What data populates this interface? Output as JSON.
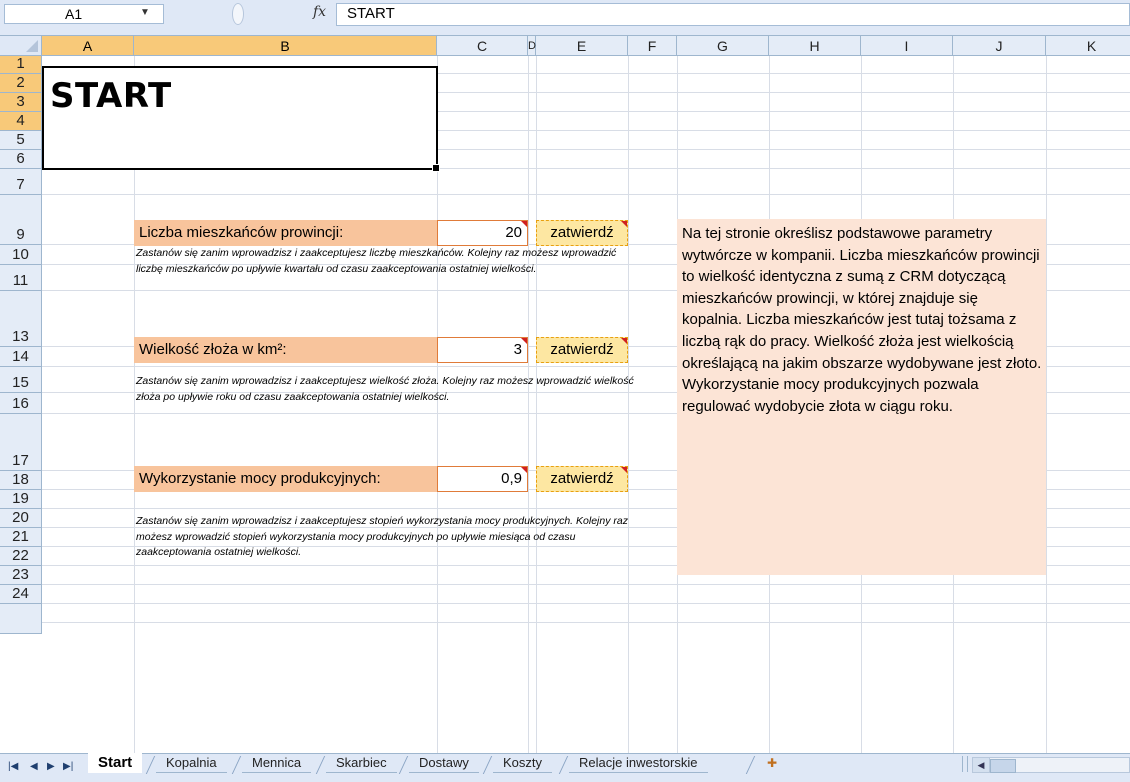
{
  "formula_bar": {
    "name_box": "A1",
    "fx": "fx",
    "formula": "START"
  },
  "columns": [
    "A",
    "B",
    "C",
    "D",
    "E",
    "F",
    "G",
    "H",
    "I",
    "J",
    "K"
  ],
  "rows": [
    "1",
    "2",
    "3",
    "4",
    "5",
    "6",
    "7",
    "9",
    "10",
    "11",
    "13",
    "14",
    "15",
    "16",
    "17",
    "18",
    "19",
    "20",
    "21",
    "22",
    "23",
    "24"
  ],
  "sheet": {
    "title": "START",
    "fields": [
      {
        "label": "Liczba mieszkańców prowincji:",
        "value": "20",
        "button": "zatwierdź",
        "note": "Zastanów się zanim wprowadzisz i zaakceptujesz liczbę mieszkańców. Kolejny raz możesz wprowadzić liczbę mieszkańców po upływie kwartału od czasu zaakceptowania ostatniej wielkości."
      },
      {
        "label": "Wielkość złoża w km²:",
        "value": "3",
        "button": "zatwierdź",
        "note": "Zastanów się zanim wprowadzisz i zaakceptujesz wielkość złoża. Kolejny raz możesz wprowadzić wielkość złoża po upływie roku od czasu zaakceptowania ostatniej wielkości."
      },
      {
        "label": "Wykorzystanie mocy produkcyjnych:",
        "value": "0,9",
        "button": "zatwierdź",
        "note": "Zastanów się zanim wprowadzisz i zaakceptujesz stopień wykorzystania mocy produkcyjnych. Kolejny raz możesz wprowadzić stopień wykorzystania mocy produkcyjnych po upływie miesiąca od czasu zaakceptowania ostatniej wielkości."
      }
    ],
    "info": "Na tej stronie określisz podstawowe parametry wytwórcze w kompanii. Liczba mieszkańców prowincji to wielkość identyczna z sumą z CRM dotyczącą mieszkańców prowincji, w której znajduje się kopalnia. Liczba mieszkańców jest tutaj tożsama z liczbą rąk do pracy. Wielkość złoża jest wielkością określającą na jakim obszarze wydobywane jest złoto. Wykorzystanie mocy produkcyjnych pozwala regulować wydobycie złota w ciągu roku."
  },
  "tabs": {
    "items": [
      "Start",
      "Kopalnia",
      "Mennica",
      "Skarbiec",
      "Dostawy",
      "Koszty",
      "Relacje inwestorskie"
    ],
    "active": "Start"
  },
  "colors": {
    "label_fill": "#f8c49c",
    "info_fill": "#fce4d6",
    "button_fill": "#fde7a2",
    "header_selected": "#f8c979"
  }
}
